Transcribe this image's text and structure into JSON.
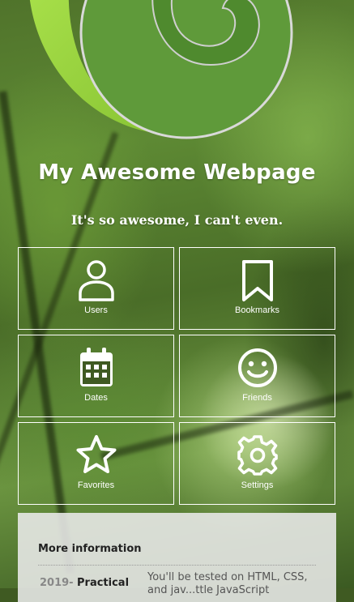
{
  "header": {
    "title": "My Awesome Webpage",
    "subtitle": "It's so awesome, I can't even."
  },
  "tiles": [
    {
      "label": "Users",
      "icon": "user-icon"
    },
    {
      "label": "Bookmarks",
      "icon": "bookmark-icon"
    },
    {
      "label": "Dates",
      "icon": "calendar-icon"
    },
    {
      "label": "Friends",
      "icon": "smiley-icon"
    },
    {
      "label": "Favorites",
      "icon": "star-icon"
    },
    {
      "label": "Settings",
      "icon": "gear-icon"
    }
  ],
  "info": {
    "heading": "More information",
    "rows": [
      {
        "year": "2019-",
        "title": "Practical",
        "text": "You'll be tested on HTML, CSS, and jav...ttle JavaScript"
      }
    ]
  },
  "colors": {
    "tile_border": "#ffffff",
    "logo_dark_green": "#5f9a3a",
    "logo_light_green": "#97d23f",
    "info_background": "#ebebeb"
  }
}
